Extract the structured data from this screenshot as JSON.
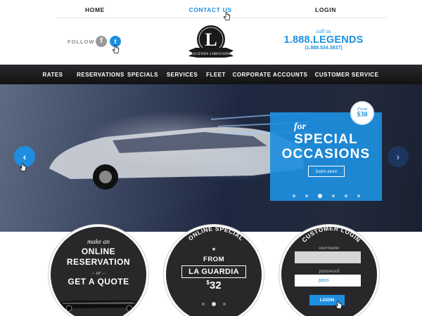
{
  "topnav": {
    "home": "HOME",
    "contact": "CONTACT US",
    "login": "LOGIN"
  },
  "header": {
    "follow": "FOLLOW",
    "facebook_glyph": "f",
    "twitter_glyph": "t",
    "logo_letter": "L",
    "logo_banner": "LEGENDS LIMOUSINE",
    "call_us": "call us",
    "phone": "1.888.LEGENDS",
    "phone_numeric": "(1.888.534.3637)"
  },
  "mainnav": [
    "RATES",
    "RESERVATIONS",
    "SPECIALS",
    "SERVICES",
    "FLEET",
    "CORPORATE ACCOUNTS",
    "CUSTOMER SERVICE"
  ],
  "hero": {
    "prev_glyph": "‹",
    "next_glyph": "›",
    "badge_from": "From",
    "badge_price": "$30",
    "for": "for",
    "title_line1": "SPECIAL",
    "title_line2": "OCCASIONS",
    "cta": "learn more",
    "slide_count": 6,
    "active_slide": 2
  },
  "reservation": {
    "make_an": "make an",
    "line1": "ONLINE",
    "line2": "RESERVATION",
    "or": "– or –",
    "line3": "GET A QUOTE"
  },
  "special": {
    "heading": "ONLINE SPECIAL",
    "star": "★",
    "from": "FROM",
    "destination": "LA GUARDIA",
    "currency": "$",
    "price": "32",
    "slide_count": 3,
    "active_slide": 1
  },
  "login": {
    "heading": "CUSTOMER LOGIN",
    "username_label": "username",
    "password_label": "password",
    "password_value": "pass",
    "button": "LOGIN"
  },
  "colors": {
    "accent": "#1e8fe0",
    "dark": "#28282b"
  }
}
